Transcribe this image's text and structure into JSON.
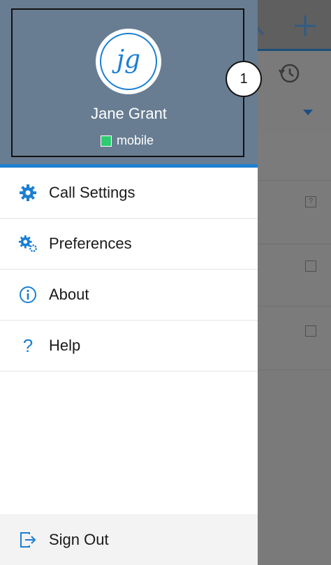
{
  "user": {
    "initials": "jg",
    "name": "Jane Grant",
    "presence": "mobile",
    "presence_color": "#2ecc71"
  },
  "menu": {
    "items": [
      {
        "label": "Call Settings",
        "icon": "gear-icon"
      },
      {
        "label": "Preferences",
        "icon": "gears-icon"
      },
      {
        "label": "About",
        "icon": "info-icon"
      },
      {
        "label": "Help",
        "icon": "question-icon"
      }
    ]
  },
  "signout": {
    "label": "Sign Out",
    "icon": "sign-out-icon"
  },
  "callout": {
    "number": "1"
  },
  "colors": {
    "accent": "#1b7fd2",
    "header_bg": "#687d92"
  }
}
